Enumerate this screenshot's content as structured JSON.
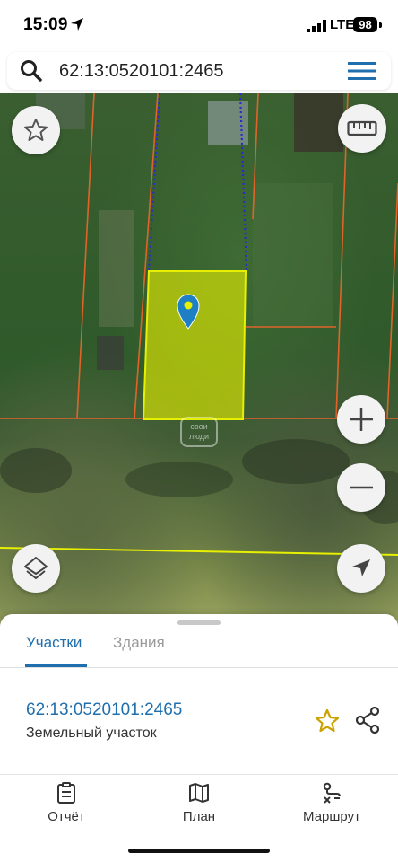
{
  "status_bar": {
    "time": "15:09",
    "network": "LTE",
    "battery": "98",
    "icons": [
      "location-arrow-icon",
      "signal-icon",
      "battery-icon"
    ]
  },
  "search": {
    "query": "62:13:0520101:2465",
    "icons": [
      "search-icon",
      "menu-icon"
    ]
  },
  "map": {
    "watermark": "свои люди",
    "highlight_color": "#e6f000",
    "boundary_color": "#e0642a",
    "marker_color": "#1f7fc4",
    "controls": [
      "favorite-star-icon",
      "ruler-icon",
      "zoom-in-icon",
      "zoom-out-icon",
      "layers-icon",
      "navigation-arrow-icon"
    ]
  },
  "sheet": {
    "tabs": [
      {
        "label": "Участки",
        "active": true
      },
      {
        "label": "Здания",
        "active": false
      }
    ],
    "result": {
      "cadastral_number": "62:13:0520101:2465",
      "type": "Земельный участок"
    },
    "accent_color": "#1f6fae"
  },
  "bottom_nav": {
    "items": [
      {
        "label": "Отчёт",
        "icon": "clipboard-icon"
      },
      {
        "label": "План",
        "icon": "map-icon"
      },
      {
        "label": "Маршрут",
        "icon": "route-icon"
      }
    ]
  }
}
